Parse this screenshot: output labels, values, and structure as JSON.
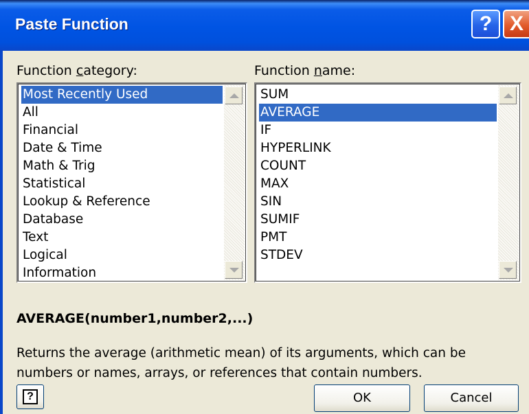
{
  "window": {
    "title": "Paste Function",
    "help_glyph": "?",
    "close_glyph": "X"
  },
  "category": {
    "label_prefix": "Function ",
    "label_accel": "c",
    "label_suffix": "ategory:",
    "items": [
      "Most Recently Used",
      "All",
      "Financial",
      "Date & Time",
      "Math & Trig",
      "Statistical",
      "Lookup & Reference",
      "Database",
      "Text",
      "Logical",
      "Information"
    ],
    "selected": "Most Recently Used"
  },
  "function": {
    "label_prefix": "Function ",
    "label_accel": "n",
    "label_suffix": "ame:",
    "items": [
      "SUM",
      "AVERAGE",
      "IF",
      "HYPERLINK",
      "COUNT",
      "MAX",
      "SIN",
      "SUMIF",
      "PMT",
      "STDEV"
    ],
    "selected": "AVERAGE"
  },
  "syntax": "AVERAGE(number1,number2,...)",
  "description": "Returns the average (arithmetic mean) of its arguments, which can be numbers or names, arrays, or references that contain numbers.",
  "buttons": {
    "help_glyph": "?",
    "ok": "OK",
    "cancel": "Cancel"
  },
  "colors": {
    "selection": "#316ac5",
    "titlebar": "#0054e3",
    "close": "#e25b2c"
  },
  "icons": [
    "help-icon",
    "close-icon",
    "arrow-up-icon",
    "arrow-down-icon",
    "help-button-icon"
  ]
}
